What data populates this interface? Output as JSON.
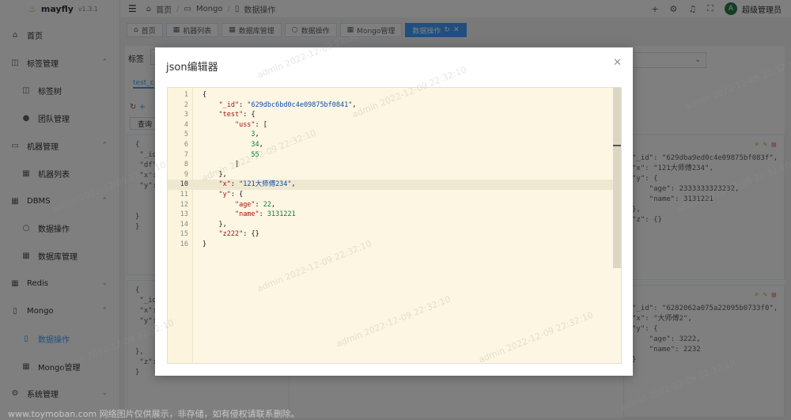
{
  "app": {
    "name": "mayfly",
    "version": "v1.3.1"
  },
  "sidebar": {
    "items": [
      {
        "label": "首页",
        "icon": "home-icon"
      },
      {
        "label": "标签管理",
        "icon": "bookmark-icon"
      },
      {
        "label": "标签树",
        "icon": "bookmark-icon"
      },
      {
        "label": "团队管理",
        "icon": "user-icon"
      },
      {
        "label": "机器管理",
        "icon": "monitor-icon"
      },
      {
        "label": "机器列表",
        "icon": "grid-icon"
      },
      {
        "label": "DBMS",
        "icon": "grid-icon"
      },
      {
        "label": "数据操作",
        "icon": "search-icon"
      },
      {
        "label": "数据库管理",
        "icon": "grid-icon"
      },
      {
        "label": "Redis",
        "icon": "grid-icon"
      },
      {
        "label": "Mongo",
        "icon": "document-icon"
      },
      {
        "label": "数据操作",
        "icon": "document-icon"
      },
      {
        "label": "Mongo管理",
        "icon": "grid-icon"
      },
      {
        "label": "系统管理",
        "icon": "gear-icon"
      }
    ]
  },
  "breadcrumb": {
    "home": "首页",
    "section": "Mongo",
    "page": "数据操作"
  },
  "user": {
    "avatar": "A",
    "name": "超级管理员"
  },
  "tabs": [
    {
      "label": "首页"
    },
    {
      "label": "机器列表"
    },
    {
      "label": "数据库管理"
    },
    {
      "label": "数据操作"
    },
    {
      "label": "Mongo管理"
    },
    {
      "label": "数据操作"
    }
  ],
  "background": {
    "tag_label": "标签",
    "collection_tab": "test_c",
    "query_button": "查询",
    "filter_value": "ll"
  },
  "dialog": {
    "title": "json编辑器",
    "current_line": 10,
    "lines": [
      "{",
      "    \"_id\": \"629dbc6bd0c4e09875bf0841\",",
      "    \"test\": {",
      "        \"uss\": [",
      "            3,",
      "            34,",
      "            55",
      "        ]",
      "    },",
      "    \"x\": \"121大师傅234\",",
      "    \"y\": {",
      "        \"age\": 22,",
      "        \"name\": 3131221",
      "    },",
      "    \"z222\": {}",
      "}"
    ]
  },
  "cards": {
    "right_top": [
      "\"_id\": \"629dba9ed0c4e09875bf083f\",",
      "\"x\": \"121大师傅234\",",
      "\"y\": {",
      "    \"age\": 2333333323232,",
      "    \"name\": 3131221",
      "},",
      "\"z\": {}"
    ],
    "right_bottom": [
      "\"_id\": \"6282062a075a22095b0733f0\",",
      "\"x\": \"大师傅2\",",
      "\"y\": {",
      "    \"age\": 3222,",
      "    \"name\": 2232",
      "}"
    ]
  },
  "watermark": "admin 2022-12-09 22:32:10",
  "footer_watermark": "www.toymoban.com 网络图片仅供展示，非存储，如有侵权请联系删除。"
}
